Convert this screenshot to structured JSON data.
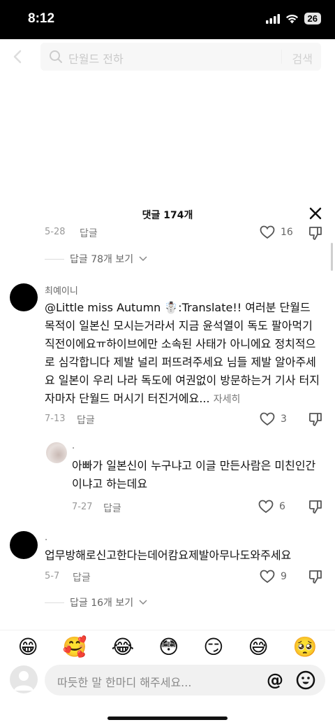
{
  "status": {
    "time": "8:12",
    "battery": "26"
  },
  "search": {
    "query": "단월드 전하",
    "submit_label": "검색"
  },
  "sheet": {
    "title": "댓글 174개"
  },
  "prev_comment": {
    "date": "5-28",
    "reply_label": "답글",
    "likes": "16",
    "more_replies": "답글 78개 보기"
  },
  "comment1": {
    "username": "최예이니",
    "text": "@Little miss Autumn ☃️:Translate!! 여러분 단월드 목적이 일본신 모시는거라서 지금 윤석열이 독도 팔아먹기 직전이에요ㅠ하이브에만 소속된 사태가 아니에요 정치적으로 심각합니다 제발 널리 퍼뜨려주세요 님들 제발 알아주세요 일본이 우리 나라 독도에 여권없이 방문하는거 기사 터지자마자 단월드 머시기 터진거에요...",
    "see_more": "자세히",
    "date": "7-13",
    "reply_label": "답글",
    "likes": "3"
  },
  "reply1": {
    "username": ".",
    "text": "아빠가 일본신이 누구냐고 이글 만든사람은 미친인간이냐고 하는데요",
    "date": "7-27",
    "reply_label": "답글",
    "likes": "6"
  },
  "comment2": {
    "username": ".",
    "text": "업무방해로신고한다는데어캄요제발아무나도와주세요",
    "date": "5-7",
    "reply_label": "답글",
    "likes": "9",
    "more_replies": "답글 16개 보기"
  },
  "emojis": [
    "😁",
    "🥰",
    "😂",
    "😳",
    "😏",
    "😅",
    "🥺"
  ],
  "composer": {
    "placeholder": "따듯한 말 한마디 해주세요..."
  }
}
